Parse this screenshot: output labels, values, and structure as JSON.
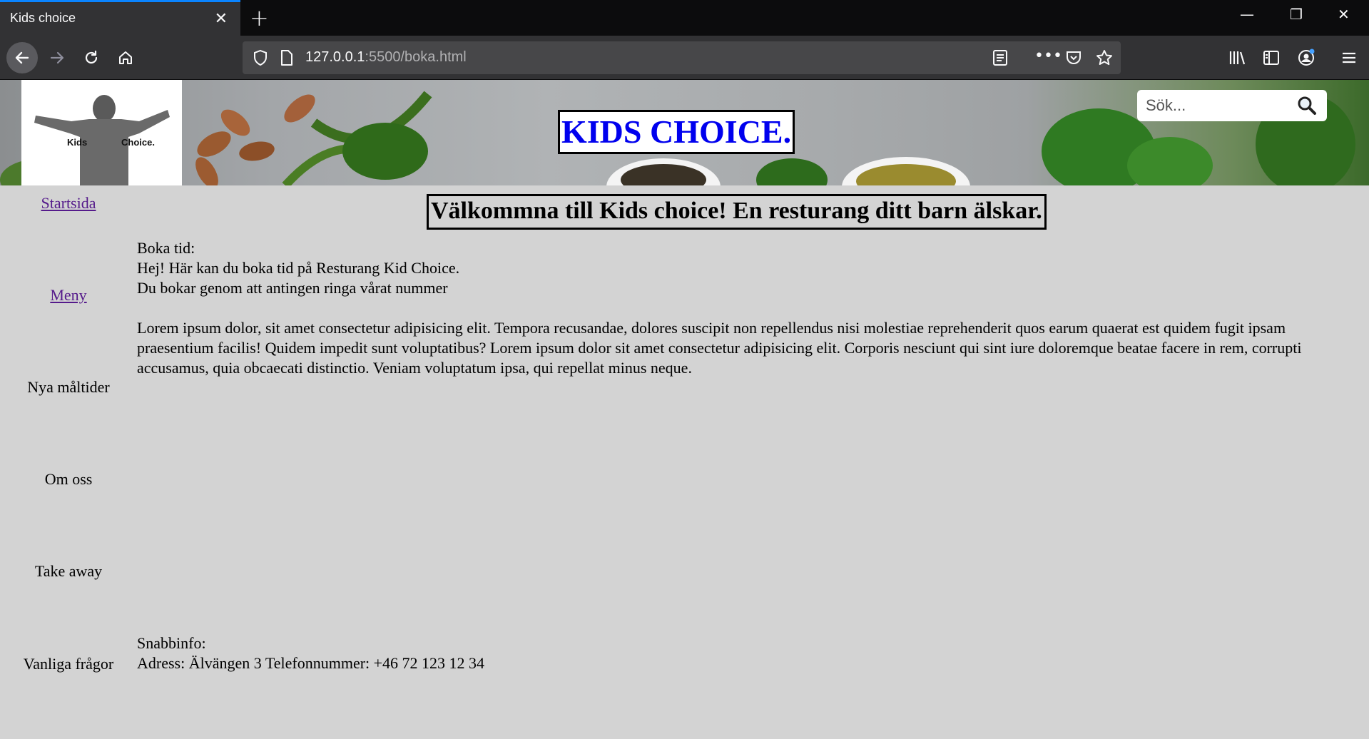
{
  "browser": {
    "tab_title": "Kids choice",
    "url_host": "127.0.0.1",
    "url_path": ":5500/boka.html"
  },
  "header": {
    "logo_left": "Kids",
    "logo_right": "Choice.",
    "site_title": "KIDS CHOICE.",
    "search_placeholder": "Sök..."
  },
  "sidebar": {
    "items": [
      {
        "label": "Startsida",
        "link": true
      },
      {
        "label": "Meny",
        "link": true
      },
      {
        "label": "Nya måltider",
        "link": false
      },
      {
        "label": "Om oss",
        "link": false
      },
      {
        "label": "Take away",
        "link": false
      },
      {
        "label": "Vanliga frågor",
        "link": false
      }
    ]
  },
  "main": {
    "welcome": "Välkommna till Kids choice! En resturang ditt barn älskar.",
    "booking_heading": "Boka tid:",
    "booking_line1": "Hej! Här kan du boka tid på Resturang Kid Choice.",
    "booking_line2": "Du bokar genom att antingen ringa vårat nummer",
    "lorem": "Lorem ipsum dolor, sit amet consectetur adipisicing elit. Tempora recusandae, dolores suscipit non repellendus nisi molestiae reprehenderit quos earum quaerat est quidem fugit ipsam praesentium facilis! Quidem impedit sunt voluptatibus? Lorem ipsum dolor sit amet consectetur adipisicing elit. Corporis nesciunt qui sint iure doloremque beatae facere in rem, corrupti accusamus, quia obcaecati distinctio. Veniam voluptatum ipsa, qui repellat minus neque."
  },
  "footer": {
    "quick_heading": "Snabbinfo:",
    "quick_info": "Adress: Älvängen 3 Telefonnummer: +46 72 123 12 34"
  }
}
